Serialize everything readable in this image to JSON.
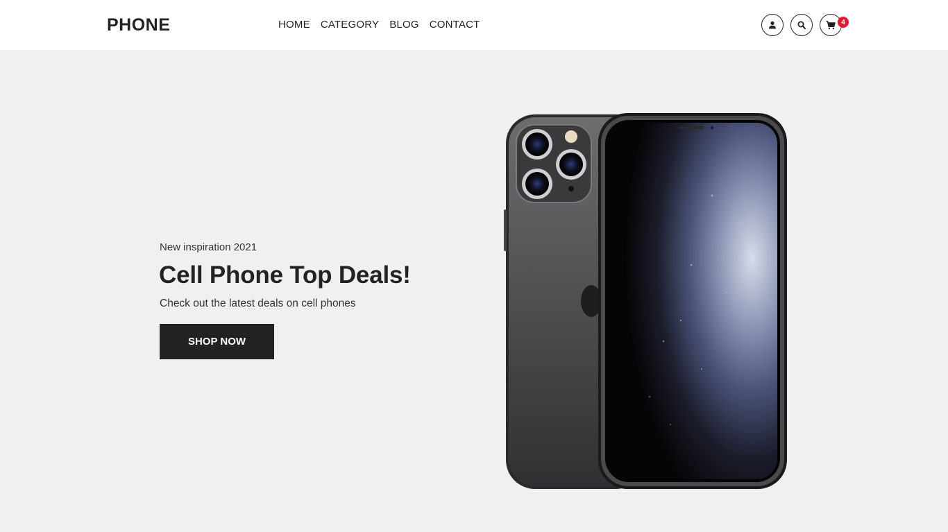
{
  "brand": {
    "logo": "PHONE"
  },
  "nav": {
    "items": [
      {
        "label": "HOME"
      },
      {
        "label": "CATEGORY"
      },
      {
        "label": "BLOG"
      },
      {
        "label": "CONTACT"
      }
    ]
  },
  "header_icons": {
    "account": "user-icon",
    "search": "search-icon",
    "cart": "cart-icon",
    "cart_count": "4"
  },
  "hero": {
    "eyebrow": "New inspiration 2021",
    "headline": "Cell Phone Top Deals!",
    "subtext": "Check out the latest deals on cell phones",
    "cta_label": "SHOP NOW"
  },
  "colors": {
    "header_bg": "#ffffff",
    "hero_bg": "#f0f0f0",
    "text": "#222222",
    "cta_bg": "#222222",
    "badge": "#e5162f"
  }
}
